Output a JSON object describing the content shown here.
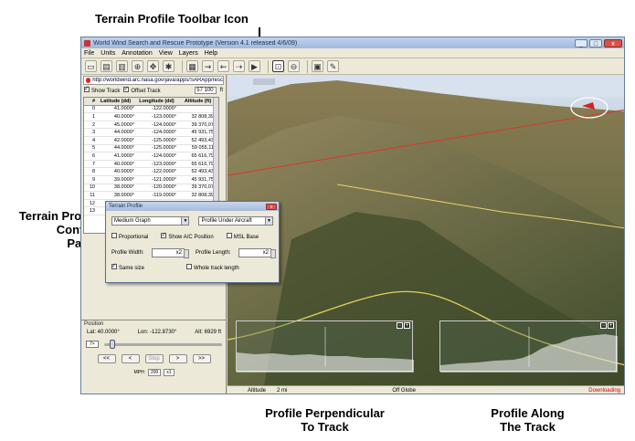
{
  "annotations": {
    "toolbar_icon": "Terrain Profile Toolbar Icon",
    "control_panel": [
      "Terrain Profile",
      "Control",
      "Panel"
    ],
    "profile_perp": [
      "Profile Perpendicular",
      "To Track"
    ],
    "profile_along": [
      "Profile Along",
      "The Track"
    ]
  },
  "window": {
    "title": "World Wind Search and Rescue Prototype (Version 4.1 released 4/6/09)",
    "minimize": "_",
    "maximize": "□",
    "close": "x"
  },
  "menu": [
    "File",
    "Units",
    "Annotation",
    "View",
    "Layers",
    "Help"
  ],
  "toolbar": {
    "icons": [
      "open-icon",
      "save-icon",
      "copy-icon",
      "zoom-icon",
      "move-icon",
      "crosshair-icon",
      "terrain-view-icon",
      "track-icon",
      "track-alt-icon",
      "track-add-icon",
      "play-icon",
      "terrain-profile-icon",
      "aircraft-icon",
      "layer-icon",
      "annotation-icon"
    ],
    "glyphs": [
      "▭",
      "▤",
      "▥",
      "⊕",
      "✥",
      "✱",
      "▦",
      "⇝",
      "⇜",
      "⇢",
      "▶",
      "⊡",
      "⊖",
      "▣",
      "✎"
    ]
  },
  "left_panel": {
    "url": "http://worldwind.arc.nasa.gov/java/apps/SARApp/rescueTrack",
    "show_track_label": "Show Track",
    "offset_track_label": "Offset Track",
    "offset_value": "57 100",
    "offset_unit": "ft",
    "table": {
      "headers": [
        "#",
        "Latitude (dd)",
        "Longitude (dd)",
        "Altitude (ft)"
      ],
      "rows": [
        [
          "0",
          "41.0000°",
          "-122.0000°",
          ""
        ],
        [
          "1",
          "40.0000°",
          "-123.0000°",
          "32 808,399"
        ],
        [
          "2",
          "45.0000°",
          "-124.0000°",
          "39 370,079"
        ],
        [
          "3",
          "44.0000°",
          "-124.0000°",
          "45 931,759"
        ],
        [
          "4",
          "42.0000°",
          "-125.0000°",
          "52 493,438"
        ],
        [
          "5",
          "44.0000°",
          "-125.0000°",
          "59 055,118"
        ],
        [
          "6",
          "41.0000°",
          "-124.0000°",
          "65 616,798"
        ],
        [
          "7",
          "40.0000°",
          "-123.0000°",
          "65 616,798"
        ],
        [
          "8",
          "40.0000°",
          "-122.0000°",
          "52 493,438"
        ],
        [
          "9",
          "39.0000°",
          "-121.0000°",
          "45 931,759"
        ],
        [
          "10",
          "38.0000°",
          "-120.0000°",
          "39 370,079"
        ],
        [
          "11",
          "38.0000°",
          "-119.0000°",
          "32 808,399"
        ],
        [
          "12",
          "36.0000°",
          "-118.0000°",
          "32 808,399"
        ],
        [
          "13",
          "36.0000°",
          "-117.0000°",
          "32 808,399"
        ]
      ]
    }
  },
  "position": {
    "title": "Position",
    "lat": "Lat: 40.0000°",
    "lon": "Lon: -122.8730°",
    "alt_label": "Alt:",
    "alt_value": "6929 ft",
    "speed": "7×",
    "buttons": [
      "<<",
      "<",
      "Stop",
      ">",
      ">>"
    ],
    "mph_label": "MPH:",
    "mph_value": "200",
    "multiplier": "x1"
  },
  "terrain_dialog": {
    "title": "Terrain Profile",
    "graph_size": "Medium Graph",
    "follow_mode": "Profile Under Aircraft",
    "proportional_label": "Proportional",
    "show_ac_label": "Show A/C Position",
    "msl_label": "MSL Base",
    "width_label": "Profile Width:",
    "width_multiplier": "x2",
    "length_label": "Profile Length:",
    "length_multiplier": "x2",
    "same_size_label": "Same size",
    "whole_track_label": "Whole track length"
  },
  "status": {
    "altitude_label": "Altitude",
    "altitude_value": "2 mi",
    "globe_status": "Off Globe",
    "downloading": "Downloading"
  }
}
